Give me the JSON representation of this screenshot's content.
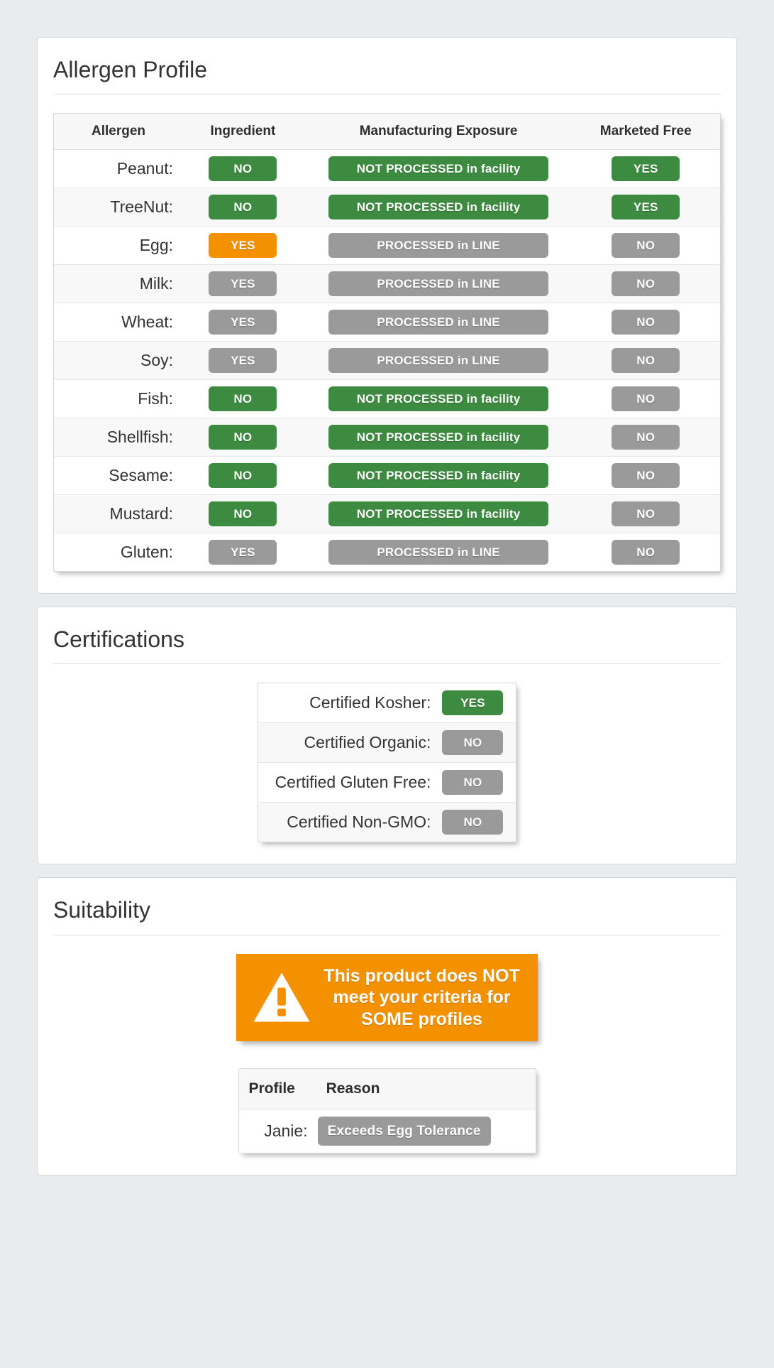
{
  "allergen_panel": {
    "title": "Allergen Profile",
    "columns": [
      "Allergen",
      "Ingredient",
      "Manufacturing Exposure",
      "Marketed Free"
    ],
    "rows": [
      {
        "allergen": "Peanut:",
        "ingredient": "NO",
        "ingredient_color": "green",
        "exposure": "NOT PROCESSED in facility",
        "exposure_color": "green",
        "marketed_free": "YES",
        "marketed_free_color": "green"
      },
      {
        "allergen": "TreeNut:",
        "ingredient": "NO",
        "ingredient_color": "green",
        "exposure": "NOT PROCESSED in facility",
        "exposure_color": "green",
        "marketed_free": "YES",
        "marketed_free_color": "green"
      },
      {
        "allergen": "Egg:",
        "ingredient": "YES",
        "ingredient_color": "orange",
        "exposure": "PROCESSED in LINE",
        "exposure_color": "gray",
        "marketed_free": "NO",
        "marketed_free_color": "gray"
      },
      {
        "allergen": "Milk:",
        "ingredient": "YES",
        "ingredient_color": "gray",
        "exposure": "PROCESSED in LINE",
        "exposure_color": "gray",
        "marketed_free": "NO",
        "marketed_free_color": "gray"
      },
      {
        "allergen": "Wheat:",
        "ingredient": "YES",
        "ingredient_color": "gray",
        "exposure": "PROCESSED in LINE",
        "exposure_color": "gray",
        "marketed_free": "NO",
        "marketed_free_color": "gray"
      },
      {
        "allergen": "Soy:",
        "ingredient": "YES",
        "ingredient_color": "gray",
        "exposure": "PROCESSED in LINE",
        "exposure_color": "gray",
        "marketed_free": "NO",
        "marketed_free_color": "gray"
      },
      {
        "allergen": "Fish:",
        "ingredient": "NO",
        "ingredient_color": "green",
        "exposure": "NOT PROCESSED in facility",
        "exposure_color": "green",
        "marketed_free": "NO",
        "marketed_free_color": "gray"
      },
      {
        "allergen": "Shellfish:",
        "ingredient": "NO",
        "ingredient_color": "green",
        "exposure": "NOT PROCESSED in facility",
        "exposure_color": "green",
        "marketed_free": "NO",
        "marketed_free_color": "gray"
      },
      {
        "allergen": "Sesame:",
        "ingredient": "NO",
        "ingredient_color": "green",
        "exposure": "NOT PROCESSED in facility",
        "exposure_color": "green",
        "marketed_free": "NO",
        "marketed_free_color": "gray"
      },
      {
        "allergen": "Mustard:",
        "ingredient": "NO",
        "ingredient_color": "green",
        "exposure": "NOT PROCESSED in facility",
        "exposure_color": "green",
        "marketed_free": "NO",
        "marketed_free_color": "gray"
      },
      {
        "allergen": "Gluten:",
        "ingredient": "YES",
        "ingredient_color": "gray",
        "exposure": "PROCESSED in LINE",
        "exposure_color": "gray",
        "marketed_free": "NO",
        "marketed_free_color": "gray"
      }
    ]
  },
  "certifications_panel": {
    "title": "Certifications",
    "rows": [
      {
        "label": "Certified Kosher:",
        "value": "YES",
        "color": "green"
      },
      {
        "label": "Certified Organic:",
        "value": "NO",
        "color": "gray"
      },
      {
        "label": "Certified Gluten Free:",
        "value": "NO",
        "color": "gray"
      },
      {
        "label": "Certified Non-GMO:",
        "value": "NO",
        "color": "gray"
      }
    ]
  },
  "suitability_panel": {
    "title": "Suitability",
    "warning": {
      "icon": "warning-triangle-icon",
      "text": "This product does NOT meet your criteria for SOME profiles"
    },
    "profile_columns": [
      "Profile",
      "Reason"
    ],
    "profile_rows": [
      {
        "profile": "Janie:",
        "reason": "Exceeds Egg Tolerance",
        "color": "gray"
      }
    ]
  },
  "colors": {
    "green": "#3d8b40",
    "gray": "#9a9a9a",
    "orange": "#f49100",
    "page_background": "#e9ebee",
    "panel_background": "#ffffff",
    "text": "#333333"
  }
}
